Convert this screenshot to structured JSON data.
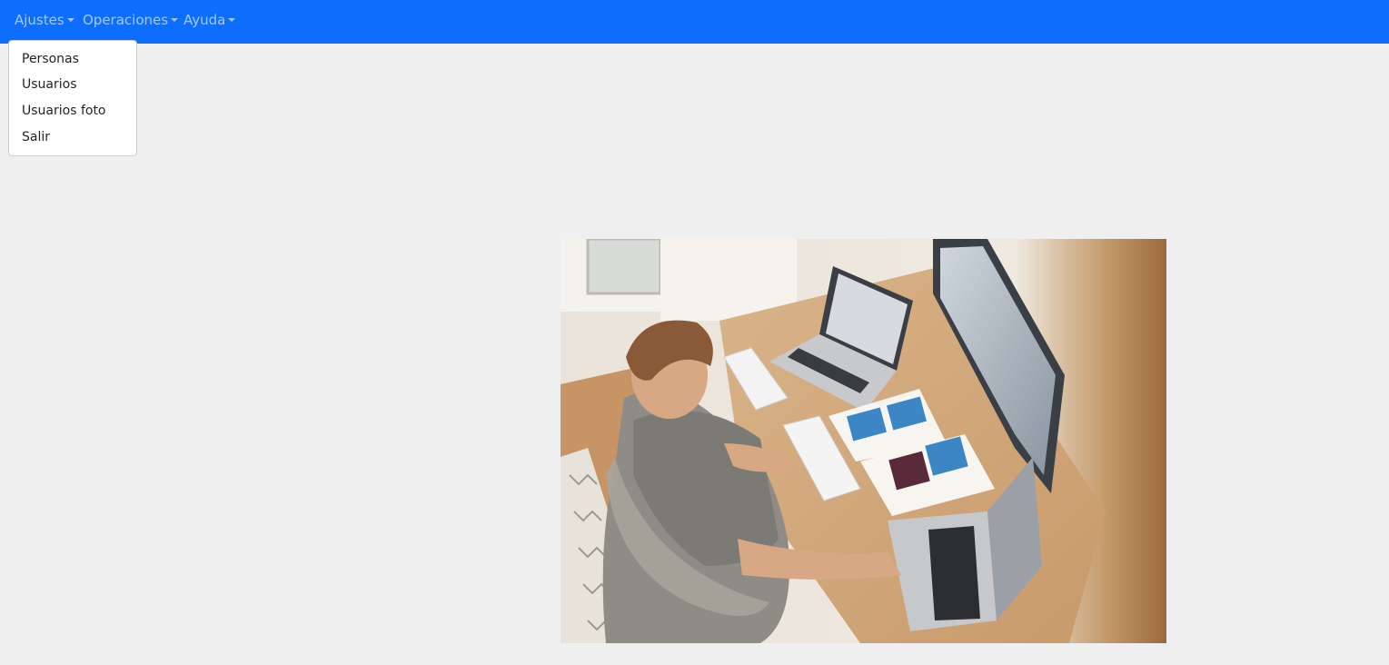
{
  "navbar": {
    "menus": [
      {
        "label": "Ajustes"
      },
      {
        "label": "Operaciones"
      },
      {
        "label": "Ayuda"
      }
    ],
    "bg_color": "#0d6efd"
  },
  "dropdown": {
    "items": [
      {
        "label": "Personas"
      },
      {
        "label": "Usuarios"
      },
      {
        "label": "Usuarios foto"
      },
      {
        "label": "Salir"
      }
    ]
  },
  "hero": {
    "subject": "person working at desk with laptops, keyboards and notebooks"
  }
}
